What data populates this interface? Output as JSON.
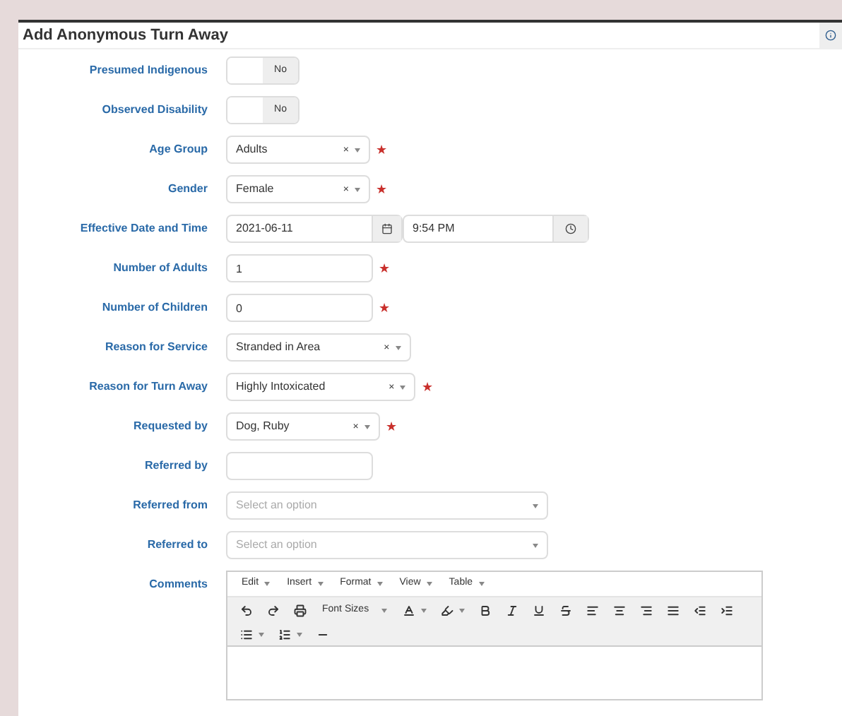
{
  "title": "Add Anonymous Turn Away",
  "fields": [
    {
      "kind": "toggle",
      "label": "Presumed Indigenous",
      "on": false,
      "value": "No"
    },
    {
      "kind": "toggle",
      "label": "Observed Disability",
      "on": false,
      "value": "No"
    },
    {
      "kind": "select",
      "label": "Age Group",
      "value": "Adults",
      "clear": "×",
      "required": "★"
    },
    {
      "kind": "select",
      "label": "Gender",
      "value": "Female",
      "clear": "×",
      "required": "★"
    },
    {
      "kind": "datetime",
      "label": "Effective Date and Time",
      "date": "2021-06-11",
      "time": "9:54 PM"
    },
    {
      "kind": "text",
      "label": "Number of Adults",
      "value": "1",
      "required": "★"
    },
    {
      "kind": "text",
      "label": "Number of Children",
      "value": "0",
      "required": "★"
    },
    {
      "kind": "select",
      "label": "Reason for Service",
      "value": "Stranded in Area",
      "clear": "×"
    },
    {
      "kind": "select",
      "label": "Reason for Turn Away",
      "value": "Highly Intoxicated",
      "clear": "×",
      "required": "★"
    },
    {
      "kind": "select",
      "label": "Requested by",
      "value": "Dog, Ruby",
      "clear": "×",
      "required": "★"
    },
    {
      "kind": "text",
      "label": "Referred by"
    },
    {
      "kind": "select",
      "label": "Referred from",
      "placeholder": "Select an option"
    },
    {
      "kind": "select",
      "label": "Referred to",
      "placeholder": "Select an option"
    },
    {
      "kind": "editor",
      "label": "Comments",
      "menus": [
        "Edit",
        "Insert",
        "Format",
        "View",
        "Table"
      ],
      "font_sizes": "Font Sizes"
    }
  ]
}
